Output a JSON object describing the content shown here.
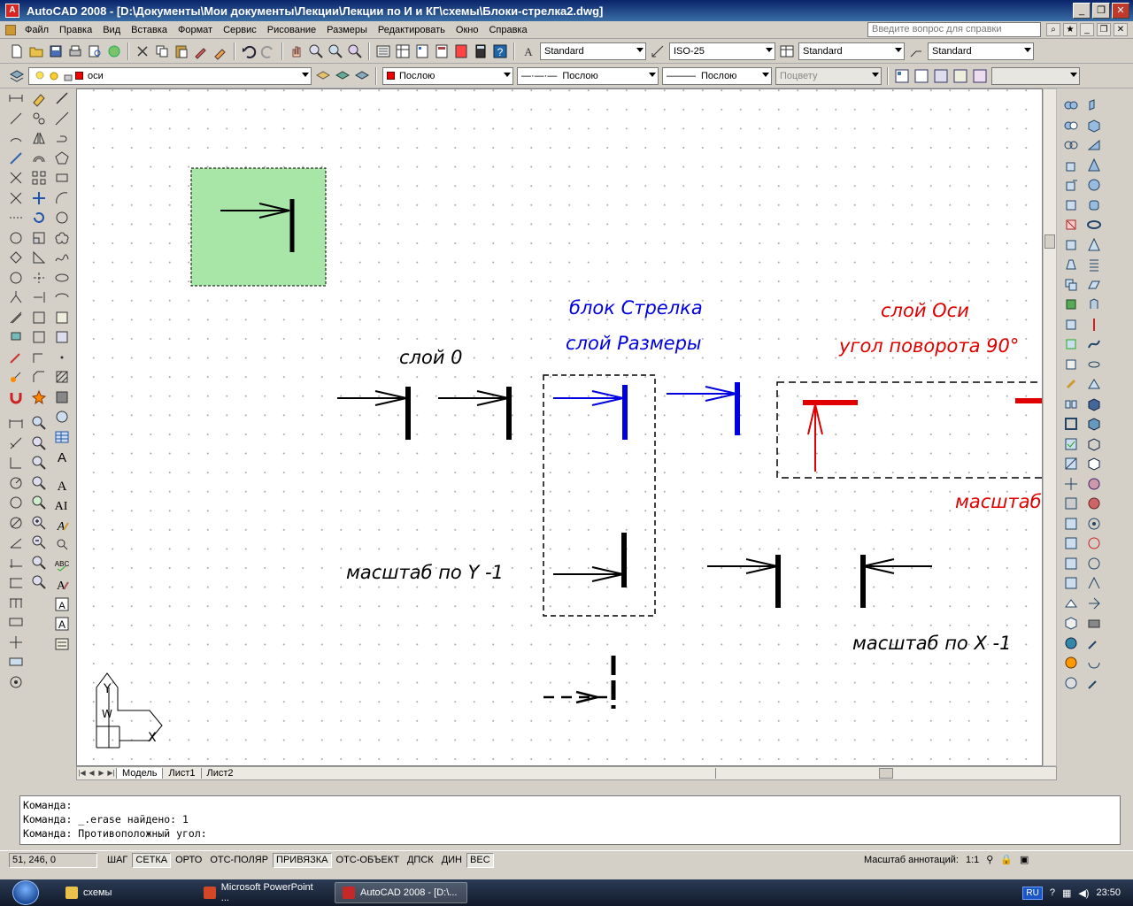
{
  "window": {
    "title": "AutoCAD 2008 - [D:\\Документы\\Мои документы\\Лекции\\Лекции по И и КГ\\схемы\\Блоки-стрелка2.dwg]",
    "minimize": "_",
    "restore": "❐",
    "close": "✕"
  },
  "menu": {
    "items": [
      "Файл",
      "Правка",
      "Вид",
      "Вставка",
      "Формат",
      "Сервис",
      "Рисование",
      "Размеры",
      "Редактировать",
      "Окно",
      "Справка"
    ],
    "help_placeholder": "Введите вопрос для справки"
  },
  "styles_toolbar": {
    "text_style": "Standard",
    "dim_style": "ISO-25",
    "table_style": "Standard",
    "mleader_style": "Standard"
  },
  "layers_toolbar": {
    "current_layer": "оси",
    "color": "Послою",
    "linetype": "Послою",
    "lineweight": "Послою",
    "plotstyle": "Поцвету",
    "layer_color": "#e00000"
  },
  "drawing": {
    "labels": {
      "layer0": "слой 0",
      "block_arrow": "блок Стрелка",
      "layer_dims": "слой Размеры",
      "layer_axes": "слой Оси",
      "rotation": "угол поворота 90°",
      "scale_y": "масштаб по Y -1",
      "scale_x": "масштаб по X -1",
      "scale_partial": "масштаб"
    },
    "ucs": {
      "y": "Y",
      "x": "X",
      "w": "W"
    },
    "colors": {
      "blue": "#0000e0",
      "red": "#e00000",
      "highlight": "#a8e6a8"
    }
  },
  "tabs": [
    "Модель",
    "Лист1",
    "Лист2"
  ],
  "command_line": [
    "Команда:",
    "Команда: _.erase найдено: 1",
    "Команда: Противоположный угол:"
  ],
  "status": {
    "coords": "51, 246, 0",
    "toggles": [
      {
        "label": "ШАГ",
        "on": false
      },
      {
        "label": "СЕТКА",
        "on": true
      },
      {
        "label": "ОРТО",
        "on": false
      },
      {
        "label": "ОТС-ПОЛЯР",
        "on": false
      },
      {
        "label": "ПРИВЯЗКА",
        "on": true
      },
      {
        "label": "ОТС-ОБЪЕКТ",
        "on": false
      },
      {
        "label": "ДПСК",
        "on": false
      },
      {
        "label": "ДИН",
        "on": false
      },
      {
        "label": "ВЕС",
        "on": true
      }
    ],
    "annotation_scale_label": "Масштаб аннотаций:",
    "annotation_scale": "1:1"
  },
  "taskbar": {
    "items": [
      {
        "label": "схемы",
        "active": false
      },
      {
        "label": "Microsoft PowerPoint ...",
        "active": false
      },
      {
        "label": "AutoCAD 2008 - [D:\\...",
        "active": true
      }
    ],
    "lang": "RU",
    "time": "23:50"
  }
}
